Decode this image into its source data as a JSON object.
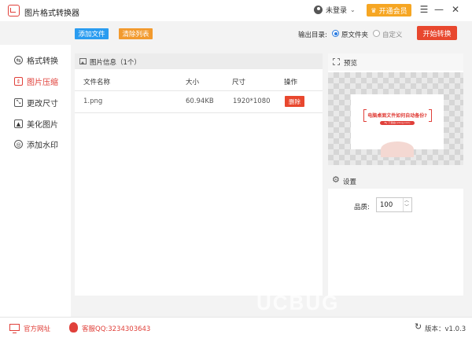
{
  "app": {
    "title": "图片格式转换器"
  },
  "user": {
    "label": "未登录",
    "vip_label": "开通会员"
  },
  "window_controls": {
    "menu": "☰",
    "minimize": "—",
    "close": "✕"
  },
  "toolbar": {
    "add_file": "添加文件",
    "clear_list": "清除列表",
    "output_dir_label": "输出目录:",
    "output_options": [
      {
        "label": "原文件夹",
        "selected": true
      },
      {
        "label": "自定义",
        "selected": false
      }
    ],
    "start_button": "开始转换"
  },
  "sidebar": {
    "items": [
      {
        "label": "格式转换",
        "icon": "convert-icon",
        "active": false
      },
      {
        "label": "图片压缩",
        "icon": "compress-icon",
        "active": true
      },
      {
        "label": "更改尺寸",
        "icon": "resize-icon",
        "active": false
      },
      {
        "label": "美化图片",
        "icon": "beautify-icon",
        "active": false
      },
      {
        "label": "添加水印",
        "icon": "watermark-icon",
        "active": false
      }
    ]
  },
  "file_panel": {
    "title": "图片信息（1个）",
    "columns": [
      "文件名称",
      "大小",
      "尺寸",
      "操作"
    ],
    "rows": [
      {
        "name": "1.png",
        "size": "60.94KB",
        "dimensions": "1920*1080",
        "action": "删除"
      }
    ]
  },
  "preview": {
    "title": "预览",
    "thumb_title": "电脑桌面文件如何自动备份?",
    "thumb_pill": "By 下载站(ucbug.com)"
  },
  "settings": {
    "title": "设置",
    "quality_label": "品质:",
    "quality_value": "100"
  },
  "footer": {
    "website": "官方网址",
    "support": "客服QQ:3234303643",
    "version": "版本：v1.0.3"
  },
  "watermark": "UCBUG",
  "colors": {
    "accent_red": "#e8472e",
    "blue": "#2a9cf0",
    "orange": "#f29a2e",
    "vip": "#f6a623"
  }
}
